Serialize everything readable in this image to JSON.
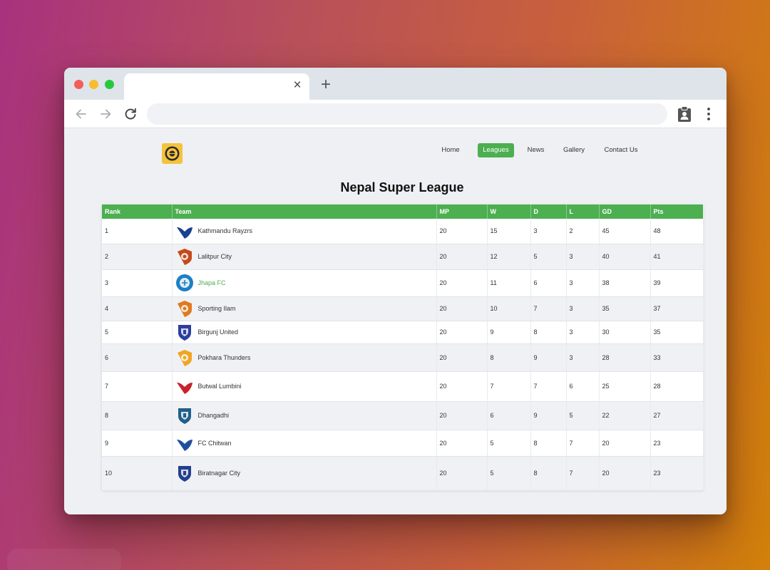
{
  "browser": {
    "tab_title": "",
    "tab_close": "×",
    "new_tab": "+",
    "address": ""
  },
  "site": {
    "nav": [
      {
        "label": "Home",
        "active": false
      },
      {
        "label": "Leagues",
        "active": true
      },
      {
        "label": "News",
        "active": false
      },
      {
        "label": "Gallery",
        "active": false
      },
      {
        "label": "Contact Us",
        "active": false
      }
    ],
    "title": "Nepal Super League"
  },
  "table": {
    "headers": {
      "rank": "Rank",
      "team": "Team",
      "mp": "MP",
      "w": "W",
      "d": "D",
      "l": "L",
      "gd": "GD",
      "pts": "Pts"
    },
    "rows": [
      {
        "rank": "1",
        "team": "Kathmandu Rayzrs",
        "crest": "kathmandu-rayzrs-crest-icon",
        "crest_color": "#1b3f91",
        "mp": "20",
        "w": "15",
        "d": "3",
        "l": "2",
        "gd": "45",
        "pts": "48"
      },
      {
        "rank": "2",
        "team": "Lalitpur City",
        "crest": "lalitpur-city-crest-icon",
        "crest_color": "#c44a1a",
        "mp": "20",
        "w": "12",
        "d": "5",
        "l": "3",
        "gd": "40",
        "pts": "41"
      },
      {
        "rank": "3",
        "team": "Jhapa FC",
        "crest": "jhapa-fc-crest-icon",
        "crest_color": "#1d7fc4",
        "mp": "20",
        "w": "11",
        "d": "6",
        "l": "3",
        "gd": "38",
        "pts": "39",
        "highlight": true
      },
      {
        "rank": "4",
        "team": "Sporting Ilam",
        "crest": "sporting-ilam-crest-icon",
        "crest_color": "#e07a1f",
        "mp": "20",
        "w": "10",
        "d": "7",
        "l": "3",
        "gd": "35",
        "pts": "37"
      },
      {
        "rank": "5",
        "team": "Birgunj United",
        "crest": "birgunj-united-crest-icon",
        "crest_color": "#2c3e9e",
        "mp": "20",
        "w": "9",
        "d": "8",
        "l": "3",
        "gd": "30",
        "pts": "35"
      },
      {
        "rank": "6",
        "team": "Pokhara Thunders",
        "crest": "pokhara-thunders-crest-icon",
        "crest_color": "#f0a623",
        "mp": "20",
        "w": "8",
        "d": "9",
        "l": "3",
        "gd": "28",
        "pts": "33"
      },
      {
        "rank": "7",
        "team": "Butwal Lumbini",
        "crest": "butwal-lumbini-crest-icon",
        "crest_color": "#c8232c",
        "mp": "20",
        "w": "7",
        "d": "7",
        "l": "6",
        "gd": "25",
        "pts": "28"
      },
      {
        "rank": "8",
        "team": "Dhangadhi",
        "crest": "dhangadhi-crest-icon",
        "crest_color": "#1f5f8b",
        "mp": "20",
        "w": "6",
        "d": "9",
        "l": "5",
        "gd": "22",
        "pts": "27"
      },
      {
        "rank": "9",
        "team": "FC Chitwan",
        "crest": "fc-chitwan-crest-icon",
        "crest_color": "#1e4f9c",
        "mp": "20",
        "w": "5",
        "d": "8",
        "l": "7",
        "gd": "20",
        "pts": "23"
      },
      {
        "rank": "10",
        "team": "Biratnagar City",
        "crest": "biratnagar-city-crest-icon",
        "crest_color": "#233f8f",
        "mp": "20",
        "w": "5",
        "d": "8",
        "l": "7",
        "gd": "20",
        "pts": "23"
      }
    ]
  },
  "colors": {
    "accent": "#4caf50",
    "row_alt": "#f0f1f4",
    "page_bg": "#eef0f3"
  }
}
